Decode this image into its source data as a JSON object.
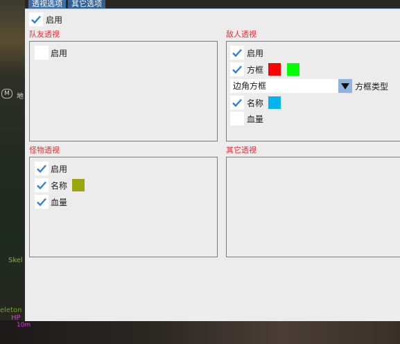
{
  "tabs": [
    "透视选项",
    "其它选项"
  ],
  "enable_all": {
    "label": "启用",
    "checked": true
  },
  "team": {
    "title": "队友透视",
    "enable": {
      "label": "启用",
      "checked": false
    }
  },
  "enemy": {
    "title": "敌人透视",
    "enable": {
      "label": "启用",
      "checked": true
    },
    "box": {
      "label": "方框",
      "checked": true,
      "colors": [
        "#ff0000",
        "#00ff00"
      ]
    },
    "box_type": {
      "value": "边角方框",
      "label": "方框类型"
    },
    "name": {
      "label": "名称",
      "checked": true,
      "color": "#00b4f0"
    },
    "health": {
      "label": "血量",
      "checked": false
    }
  },
  "monster": {
    "title": "怪物透视",
    "enable": {
      "label": "启用",
      "checked": true
    },
    "name": {
      "label": "名称",
      "checked": true,
      "color": "#9aa60a"
    },
    "health": {
      "label": "血量",
      "checked": true
    }
  },
  "other": {
    "title": "其它透视"
  },
  "background": {
    "map_key": "M",
    "map_label": "地",
    "skeleton_1": "Skel",
    "skeleton_2": "eleton",
    "hp": "HP",
    "distance": "10m"
  }
}
